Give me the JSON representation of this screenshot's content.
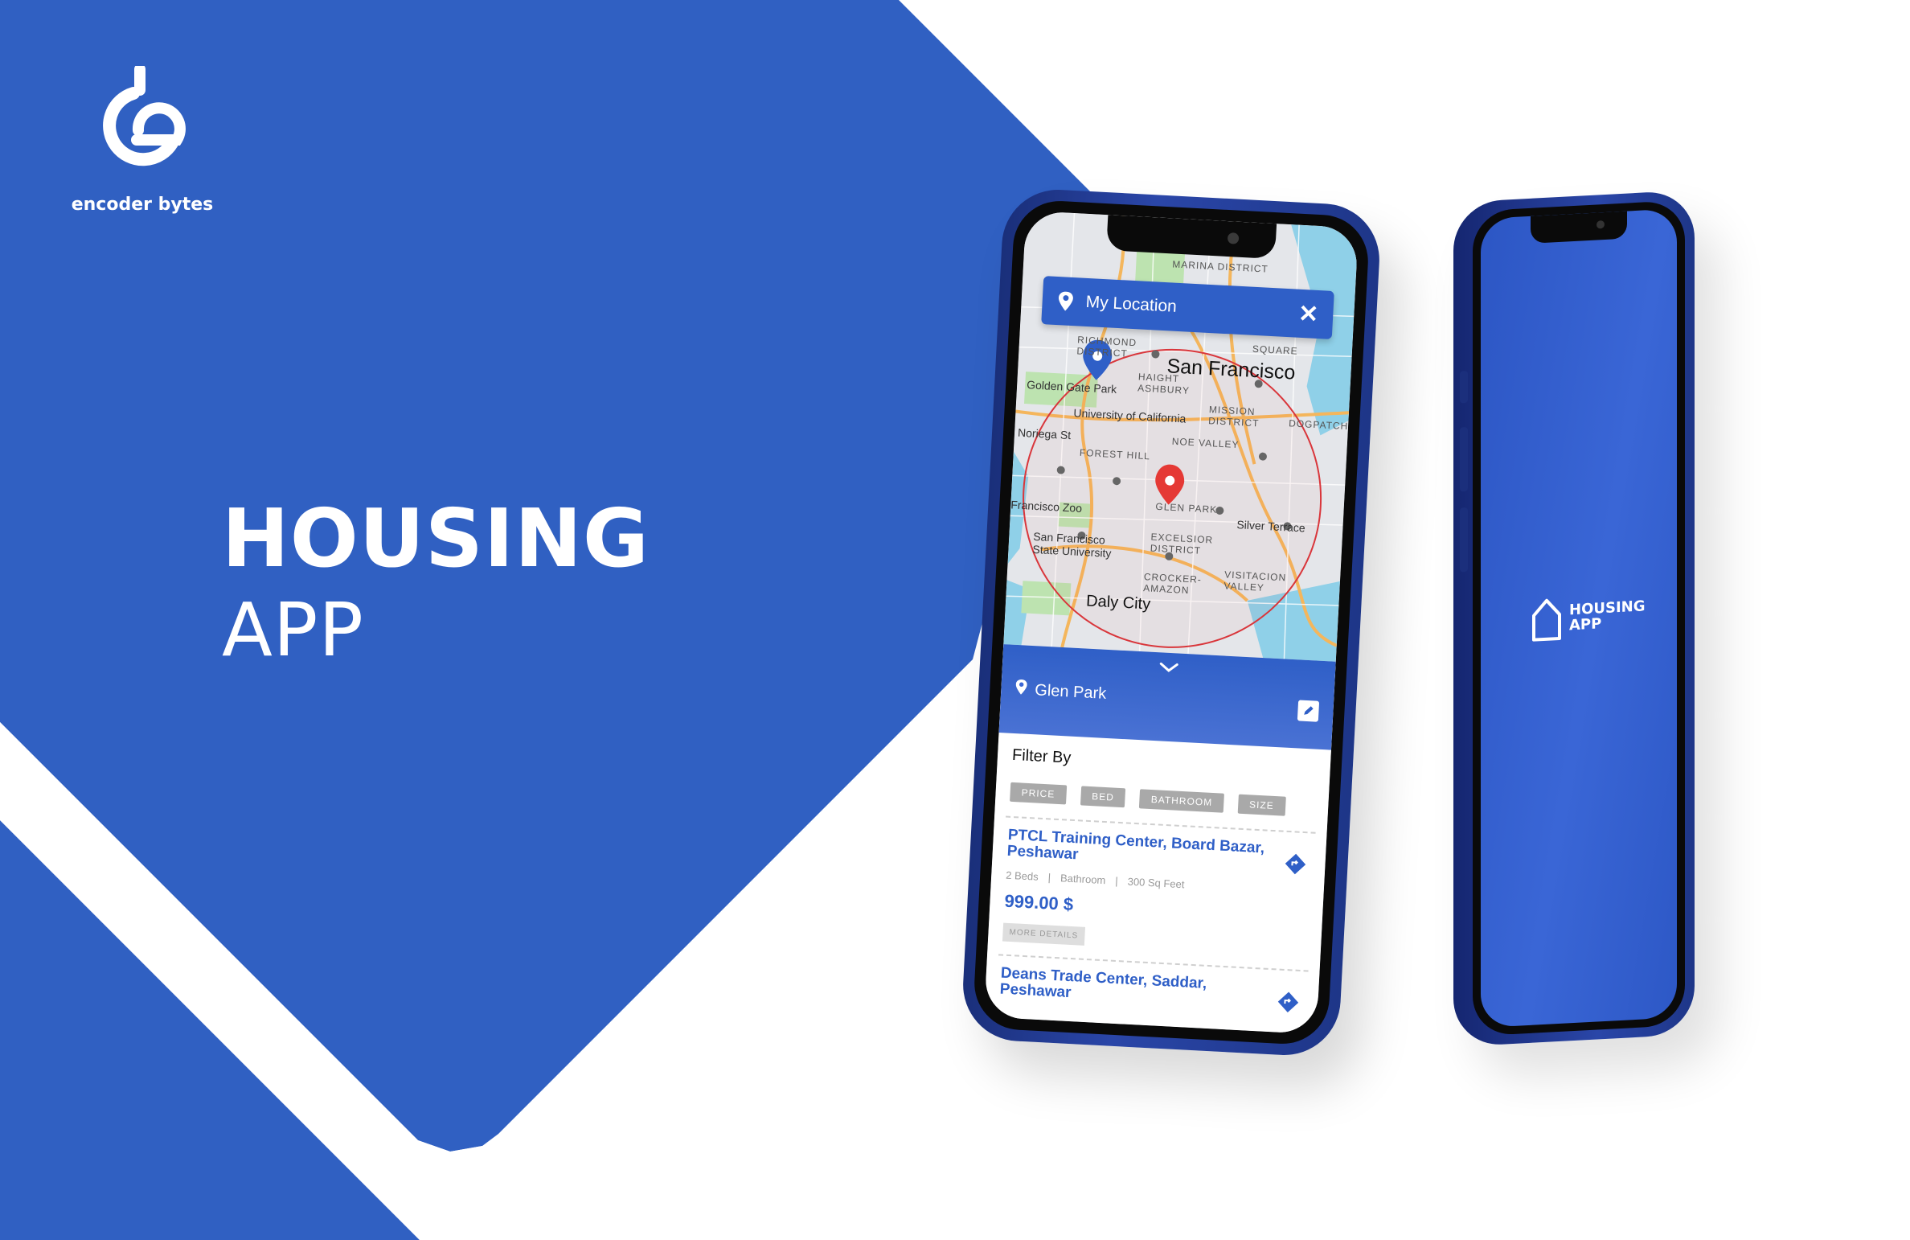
{
  "brand": {
    "name": "encoder bytes",
    "icon": "encoder-bytes-logo"
  },
  "hero": {
    "title": "HOUSING",
    "subtitle": "APP"
  },
  "colors": {
    "brand_blue": "#3060C2",
    "accent_blue": "#2f5fc7",
    "pin_red": "#e53935",
    "chip_gray": "#a9a9a9"
  },
  "phone_map": {
    "search": {
      "label": "My Location",
      "icon": "location-pin-icon",
      "close_icon": "close-icon"
    },
    "map_labels": {
      "city": "San Francisco",
      "richmond": "RICHMOND DISTRICT",
      "marina": "MARINA DISTRICT",
      "square": "SQUARE",
      "haight": "HAIGHT ASHBURY",
      "golden_gate": "Golden Gate Park",
      "university": "University of California",
      "mission": "MISSION DISTRICT",
      "dogpatch": "DOGPATCH",
      "noriega": "Noriega St",
      "forest_hill": "FOREST HILL",
      "noe_valley": "NOE VALLEY",
      "glen_park": "GLEN PARK",
      "silver_terrace": "Silver Terrace",
      "excelsior": "EXCELSIOR DISTRICT",
      "sf_zoo": "Francisco Zoo",
      "sfsu": "San Francisco State University",
      "visitacion": "VISITACION VALLEY",
      "crocker": "CROCKER-AMAZON",
      "daly_city": "Daly City"
    },
    "sheet": {
      "location": "Glen Park",
      "filter_title": "Filter By",
      "filters": [
        "PRICE",
        "BED",
        "BATHROOM",
        "SIZE"
      ],
      "listings": [
        {
          "title": "PTCL Training Center, Board Bazar, Peshawar",
          "beds": "2 Beds",
          "bath": "Bathroom",
          "size": "300 Sq Feet",
          "price": "999.00 $",
          "more": "MORE DETAILS"
        },
        {
          "title": "Deans Trade Center, Saddar, Peshawar"
        }
      ]
    }
  },
  "phone_splash": {
    "logo_icon": "house-outline-icon",
    "line1": "HOUSING",
    "line2": "APP"
  }
}
